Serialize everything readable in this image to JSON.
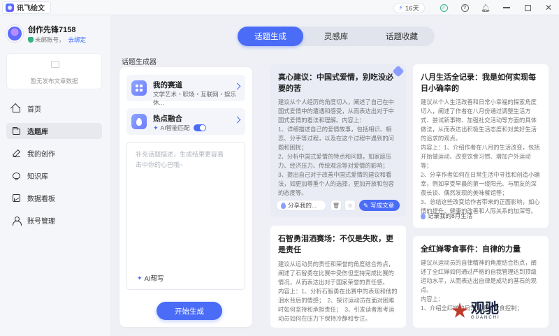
{
  "app": {
    "name": "讯飞绘文"
  },
  "titlebar": {
    "days": "16天"
  },
  "user": {
    "name": "创作先锋7158",
    "bind_status": "未绑账号，",
    "bind_link": "去绑定"
  },
  "sidebar": {
    "empty_text": "暂无发布文章数据",
    "items": [
      {
        "label": "首页",
        "icon": "home-icon"
      },
      {
        "label": "选题库",
        "icon": "folder-icon"
      },
      {
        "label": "我的创作",
        "icon": "pen-icon"
      },
      {
        "label": "知识库",
        "icon": "bulb-icon"
      },
      {
        "label": "数据看板",
        "icon": "chart-icon"
      },
      {
        "label": "账号管理",
        "icon": "user-icon"
      }
    ]
  },
  "tabs": [
    "话题生成",
    "灵感库",
    "话题收藏"
  ],
  "section_title": "话题生成器",
  "generator": {
    "track_title": "我的赛道",
    "track_sub": "文学艺术・职场・互联网・娱乐休...",
    "hot_title": "热点融合",
    "hot_sub": "AI智能匹配",
    "placeholder": "补充话题描述，生成结果更容易击中你的心巴哦~",
    "ai_help": "AI帮写",
    "start": "开始生成"
  },
  "cards": [
    {
      "title": "真心建议：中国式爱情，别吃没必要的苦",
      "body": [
        "建议从个人经历的角度切入，阐述了自己在中国式爱情中的遭遇和感受，从而表达出对于中国式爱情的看法和理解。内容上：",
        "1、详细描述自己的爱情故事，包括相识、相恋、分手等过程，以及在这个过程中遇到的问题和困扰；",
        "2、分析中国式爱情的特点和问题，如家庭压力、经济压力、传统观念等对爱情的影响；",
        "3、提出自己对于改善中国式爱情的建议和看法，如更加尊重个人的选择，更加开放和包容的态度等。"
      ],
      "tag": "分享我的...",
      "write": "写成文章"
    },
    {
      "title": "八月生活全记录：我是如何实现每日小确幸的",
      "body": [
        "建议从个人生活改善和日常小幸福的探索角度切入，阐述了作者在八月份通过调整生活方式、尝试新事物、加强社交活动等方面的具体做法，从而表达出积极生活态度和对美好生活的追求的观点。",
        "内容上：1、介绍作者在八月的生活改变，包括开始做运动、改变饮食习惯、增加户外运动等；",
        "2、分享作者如何在日常生活中寻找和创造小确幸，例如享受早晨的第一缕阳光、与朋友的深夜长谈、偶然发现的美味餐馆等；",
        "3、总结这些改变给作者带来的正面影响，如心情的提升、健康的改善和人际关系的加深等。"
      ],
      "tag": "记录我的8月生活"
    },
    {
      "title": "石智勇泪洒赛场：不仅是失败，更是责任",
      "body": [
        "建议从运动员的责任和荣誉的角度结合热点，阐述了石智勇在比赛中受伤但坚持完成比赛的情况，从而表达出对于国家荣誉的责任感。",
        "内容上：1、分析石智勇在比赛中的表现和他的泪水背后的情感；　2、探讨运动员在面对困难时如何坚持和承担责任；　3、引发读者思考运动员如何在压力下保持冷静和专注。"
      ]
    },
    {
      "title": "全红婵零食事件：自律的力量",
      "body": [
        "建议从运动员的自律精神的角度结合热点，阐述了全红婵如何通过严格的自我管理达到顶级运动水平，从而表达出自律是成功的基石的观点。",
        "内容上：",
        "1、介绍全红婵的日常训练和饮食控制；"
      ]
    }
  ],
  "watermark": {
    "text": "观驰",
    "sub": "GUANCHI"
  },
  "colors": {
    "accent": "#4a6cf7"
  }
}
